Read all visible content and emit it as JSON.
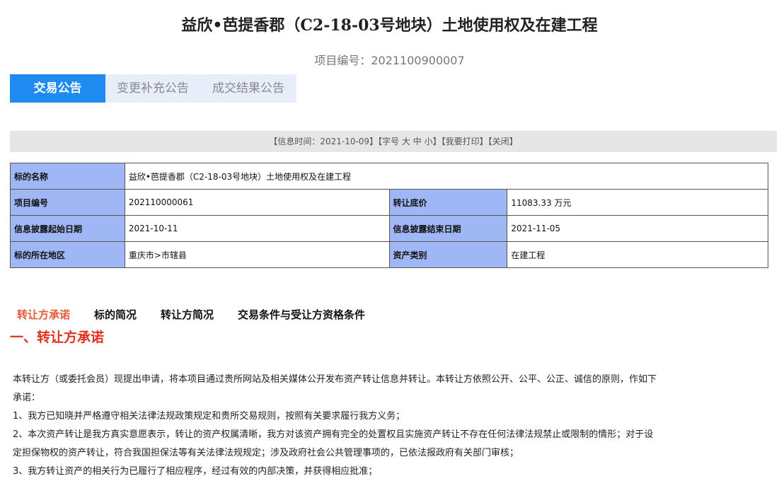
{
  "header": {
    "title": "益欣•芭提香郡（C2-18-03号地块）土地使用权及在建工程",
    "project_no_label": "项目编号：",
    "project_no": "2021100900007"
  },
  "tabs": [
    "交易公告",
    "变更补充公告",
    "成交结果公告"
  ],
  "infobar": {
    "open": "【",
    "time_label": "信息时间：",
    "time": "2021-10-09",
    "mid1": "】【字号",
    "big": "大",
    "mid": "中",
    "small": "小",
    "mid2": "】【",
    "print": "我要打印",
    "mid3": "】【",
    "close": "关闭",
    "end": "】"
  },
  "detail": {
    "name_label": "标的名称",
    "name_value": "益欣•芭提香郡（C2-18-03号地块）土地使用权及在建工程",
    "code_label": "项目编号",
    "code_value": "202110000061",
    "price_label": "转让底价",
    "price_value": "11083.33 万元",
    "start_label": "信息披露起始日期",
    "start_value": "2021-10-11",
    "end_label": "信息披露结束日期",
    "end_value": "2021-11-05",
    "region_label": "标的所在地区",
    "region_value": "重庆市>市辖县",
    "type_label": "资产类别",
    "type_value": "在建工程"
  },
  "subnav": [
    "转让方承诺",
    "标的简况",
    "转让方简况",
    "交易条件与受让方资格条件"
  ],
  "section": {
    "title": "一、转让方承诺",
    "lines": [
      "本转让方（或委托会员）现提出申请，将本项目通过贵所网站及相关媒体公开发布资产转让信息并转让。本转让方依照公开、公平、公正、诚信的原则，作如下",
      "承诺：",
      "1、我方已知晓并严格遵守相关法律法规政策规定和贵所交易规则，按照有关要求履行我方义务；",
      "2、本次资产转让是我方真实意愿表示，转让的资产权属清晰，我方对该资产拥有完全的处置权且实施资产转让不存在任何法律法规禁止或限制的情形；对于设",
      "定担保物权的资产转让，符合我国担保法等有关法律法规规定；涉及政府社会公共管理事项的，已依法报政府有关部门审核；",
      "3、我方转让资产的相关行为已履行了相应程序，经过有效的内部决策，并获得相应批准；"
    ]
  }
}
